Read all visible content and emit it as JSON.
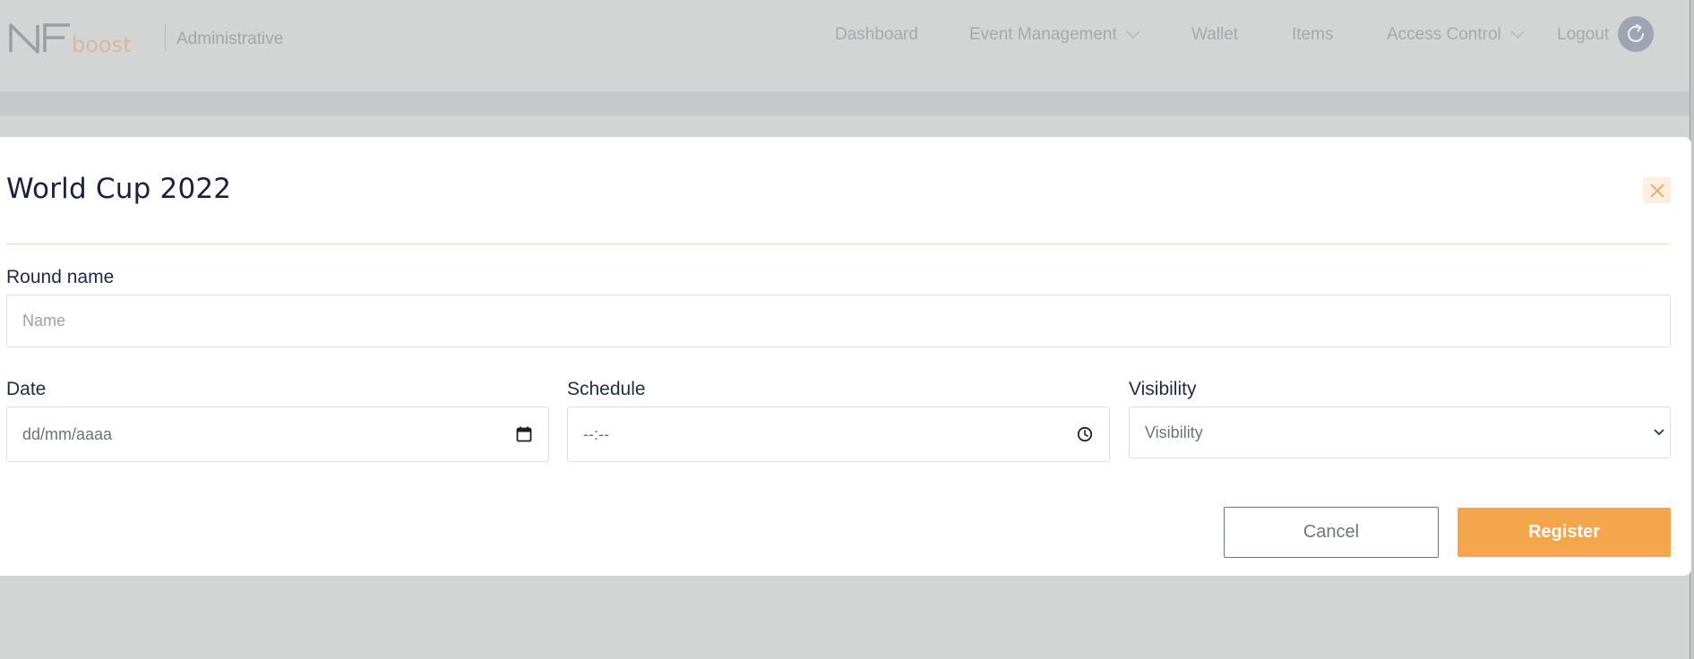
{
  "header": {
    "logo_text": "NFboost",
    "subtitle": "Administrative",
    "nav": [
      {
        "label": "Dashboard",
        "has_dropdown": false
      },
      {
        "label": "Event Management",
        "has_dropdown": true
      },
      {
        "label": "Wallet",
        "has_dropdown": false
      },
      {
        "label": "Items",
        "has_dropdown": false
      },
      {
        "label": "Access Control",
        "has_dropdown": true
      },
      {
        "label": "Logout",
        "has_dropdown": false
      }
    ],
    "avatar_icon": "refresh-user-icon"
  },
  "modal": {
    "title": "World Cup 2022",
    "close_icon": "close-icon",
    "round_name": {
      "label": "Round name",
      "placeholder": "Name",
      "value": ""
    },
    "date": {
      "label": "Date",
      "placeholder": "dd/mm/aaaa",
      "icon": "calendar-icon"
    },
    "schedule": {
      "label": "Schedule",
      "placeholder": "--:--",
      "icon": "clock-icon"
    },
    "visibility": {
      "label": "Visibility",
      "selected": "Visibility",
      "icon": "chevron-down-icon"
    },
    "cancel_label": "Cancel",
    "register_label": "Register"
  },
  "colors": {
    "accent": "#f3a64c",
    "title_text": "#1a1f44",
    "overlay": "#d3d5d5"
  }
}
